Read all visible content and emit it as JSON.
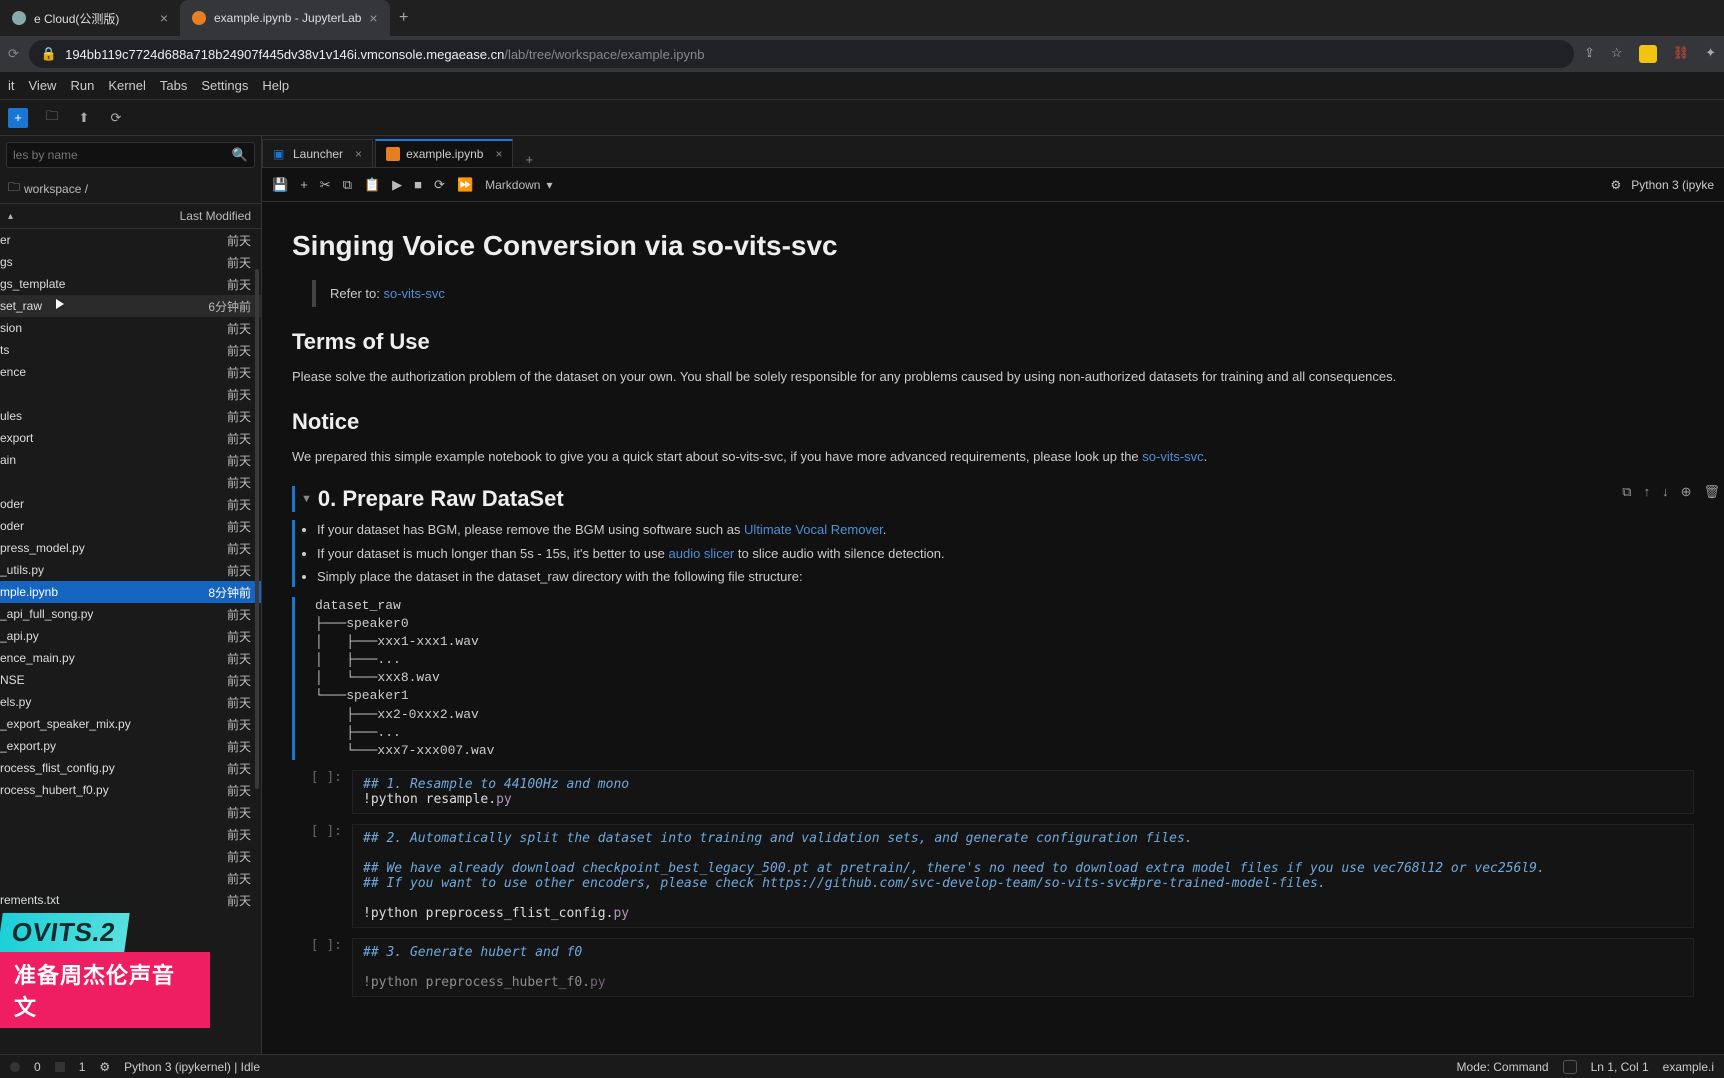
{
  "browser": {
    "tabs": [
      {
        "title": "e Cloud(公测版)",
        "active": false
      },
      {
        "title": "example.ipynb - JupyterLab",
        "active": true
      }
    ],
    "url_host": "194bb119c7724d688a718b24907f445dv38v1v146i.vmconsole.megaease.cn",
    "url_path": "/lab/tree/workspace/example.ipynb"
  },
  "menu": [
    "it",
    "View",
    "Run",
    "Kernel",
    "Tabs",
    "Settings",
    "Help"
  ],
  "filebrowser": {
    "filter_placeholder": "les by name",
    "breadcrumb": "workspace /",
    "col_modified": "Last Modified",
    "files": [
      {
        "name": "er",
        "modified": "前天"
      },
      {
        "name": "gs",
        "modified": "前天"
      },
      {
        "name": "gs_template",
        "modified": "前天"
      },
      {
        "name": "set_raw",
        "modified": "6分钟前",
        "hover": true
      },
      {
        "name": "sion",
        "modified": "前天"
      },
      {
        "name": "ts",
        "modified": "前天"
      },
      {
        "name": "ence",
        "modified": "前天"
      },
      {
        "name": "",
        "modified": "前天"
      },
      {
        "name": "ules",
        "modified": "前天"
      },
      {
        "name": "export",
        "modified": "前天"
      },
      {
        "name": "ain",
        "modified": "前天"
      },
      {
        "name": "",
        "modified": "前天"
      },
      {
        "name": "oder",
        "modified": "前天"
      },
      {
        "name": "oder",
        "modified": "前天"
      },
      {
        "name": "press_model.py",
        "modified": "前天"
      },
      {
        "name": "_utils.py",
        "modified": "前天"
      },
      {
        "name": "mple.ipynb",
        "modified": "8分钟前",
        "selected": true
      },
      {
        "name": "_api_full_song.py",
        "modified": "前天"
      },
      {
        "name": "_api.py",
        "modified": "前天"
      },
      {
        "name": "ence_main.py",
        "modified": "前天"
      },
      {
        "name": "NSE",
        "modified": "前天"
      },
      {
        "name": "els.py",
        "modified": "前天"
      },
      {
        "name": "_export_speaker_mix.py",
        "modified": "前天"
      },
      {
        "name": "_export.py",
        "modified": "前天"
      },
      {
        "name": "rocess_flist_config.py",
        "modified": "前天"
      },
      {
        "name": "rocess_hubert_f0.py",
        "modified": "前天"
      },
      {
        "name": "",
        "modified": "前天"
      },
      {
        "name": "",
        "modified": "前天"
      },
      {
        "name": "",
        "modified": "前天"
      },
      {
        "name": "",
        "modified": "前天"
      },
      {
        "name": "rements.txt",
        "modified": "前天"
      }
    ]
  },
  "editor": {
    "tabs": [
      {
        "label": "Launcher",
        "active": false
      },
      {
        "label": "example.ipynb",
        "active": true
      }
    ],
    "cell_type": "Markdown",
    "kernel": "Python 3 (ipyke"
  },
  "notebook": {
    "h1": "Singing Voice Conversion via so-vits-svc",
    "refer_label": "Refer to: ",
    "refer_link": "so-vits-svc",
    "h2_terms": "Terms of Use",
    "terms_body": "Please solve the authorization problem of the dataset on your own. You shall be solely responsible for any problems caused by using non-authorized datasets for training and all consequences.",
    "h2_notice": "Notice",
    "notice_pre": "We prepared this simple example notebook to give you a quick start about so-vits-svc, if you have more advanced requirements, please look up the ",
    "notice_link": "so-vits-svc",
    "notice_post": ".",
    "h2_prepare": "0. Prepare Raw DataSet",
    "bullets": {
      "b1_pre": "If your dataset has BGM, please remove the BGM using software such as ",
      "b1_link": "Ultimate Vocal Remover",
      "b1_post": ".",
      "b2_pre": "If your dataset is much longer than 5s - 15s, it's better to use ",
      "b2_link": "audio slicer",
      "b2_post": " to slice audio with silence detection.",
      "b3": "Simply place the dataset in the dataset_raw directory with the following file structure:"
    },
    "tree": "dataset_raw\n├───speaker0\n│   ├───xxx1-xxx1.wav\n│   ├───...\n│   └───xxx8.wav\n└───speaker1\n    ├───xx2-0xxx2.wav\n    ├───...\n    └───xxx7-xxx007.wav",
    "cell1_comment": "## 1. Resample to 44100Hz and mono",
    "cell1_code": "!python resample.py",
    "cell2_comment": "## 2. Automatically split the dataset into training and validation sets, and generate configuration files.",
    "cell2_c2": "## We have already download checkpoint_best_legacy_500.pt at pretrain/, there's no need to download extra model files if you use vec768l12 or vec256l9.",
    "cell2_c3": "## If you want to use other encoders, please check https://github.com/svc-develop-team/so-vits-svc#pre-trained-model-files.",
    "cell2_code": "!python preprocess_flist_config.py",
    "cell3_comment": "## 3. Generate hubert and f0",
    "cell3_code": "!python preprocess_hubert_f0.py",
    "prompt": "[ ]:"
  },
  "status": {
    "s0": "0",
    "s1": "1",
    "kernel": "Python 3 (ipykernel) | Idle",
    "mode": "Mode: Command",
    "lncol": "Ln 1, Col 1",
    "file": "example.i"
  },
  "overlay": {
    "top": "OVITS.2",
    "bottom": "准备周杰伦声音文"
  }
}
